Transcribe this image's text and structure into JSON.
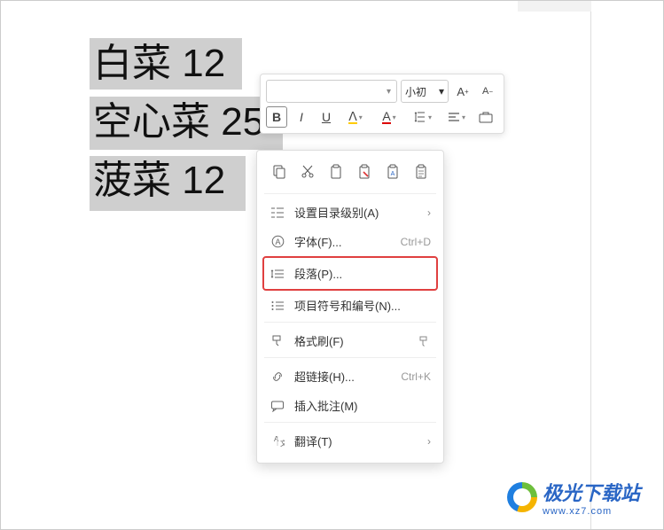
{
  "document": {
    "lines": [
      {
        "text": "白菜 12"
      },
      {
        "text": "空心菜 25"
      },
      {
        "text": "菠菜 12"
      }
    ]
  },
  "mini_toolbar": {
    "font_name": "",
    "font_size_label": "小初",
    "increase_font": "A⁺",
    "decrease_font": "A⁻",
    "bold": "B",
    "italic": "I",
    "underline": "U"
  },
  "context_menu": {
    "set_outline_level": "设置目录级别(A)",
    "font": "字体(F)...",
    "font_shortcut": "Ctrl+D",
    "paragraph": "段落(P)...",
    "bullets_numbering": "项目符号和编号(N)...",
    "format_painter": "格式刷(F)",
    "hyperlink": "超链接(H)...",
    "hyperlink_shortcut": "Ctrl+K",
    "insert_comment": "插入批注(M)",
    "translate": "翻译(T)"
  },
  "watermark": {
    "title": "极光下载站",
    "url": "www.xz7.com"
  }
}
